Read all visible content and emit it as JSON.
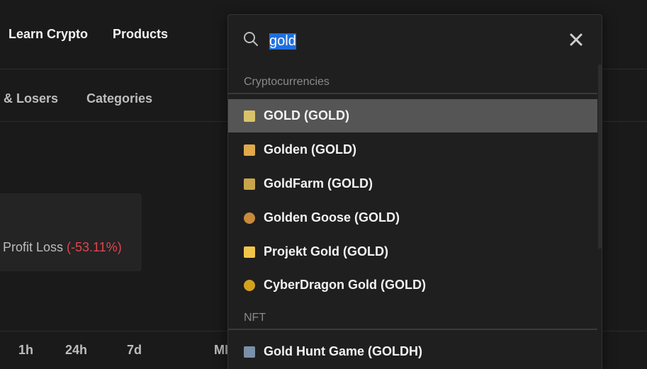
{
  "nav": {
    "learn_crypto": "Learn Crypto",
    "products": "Products"
  },
  "tabs": {
    "losers": "& Losers",
    "categories": "Categories"
  },
  "card": {
    "label": "Profit Loss ",
    "value": "(-53.11%)"
  },
  "timeframes": {
    "h1": "1h",
    "h24": "24h",
    "d7": "7d",
    "partial": "MI"
  },
  "search": {
    "value": "gold"
  },
  "dropdown": {
    "sections": {
      "crypto": "Cryptocurrencies",
      "nft": "NFT"
    },
    "crypto_items": [
      {
        "label": "GOLD (GOLD)",
        "icon": "gold-token-icon",
        "color": "#d9c36a"
      },
      {
        "label": "Golden (GOLD)",
        "icon": "golden-token-icon",
        "color": "#e0a94a"
      },
      {
        "label": "GoldFarm (GOLD)",
        "icon": "goldfarm-token-icon",
        "color": "#c9a54a"
      },
      {
        "label": "Golden Goose (GOLD)",
        "icon": "golden-goose-token-icon",
        "color": "#c98a3a"
      },
      {
        "label": "Projekt Gold (GOLD)",
        "icon": "projekt-gold-token-icon",
        "color": "#f0c64a"
      },
      {
        "label": "CyberDragon Gold (GOLD)",
        "icon": "cyberdragon-gold-token-icon",
        "color": "#d4a020"
      }
    ],
    "nft_items": [
      {
        "label": "Gold Hunt Game (GOLDH)",
        "icon": "gold-hunt-game-icon",
        "color": "#7a8fa8"
      }
    ]
  },
  "colors": {
    "negative": "#e0454f",
    "selection": "#1f6fe0",
    "active_row": "#555555"
  }
}
